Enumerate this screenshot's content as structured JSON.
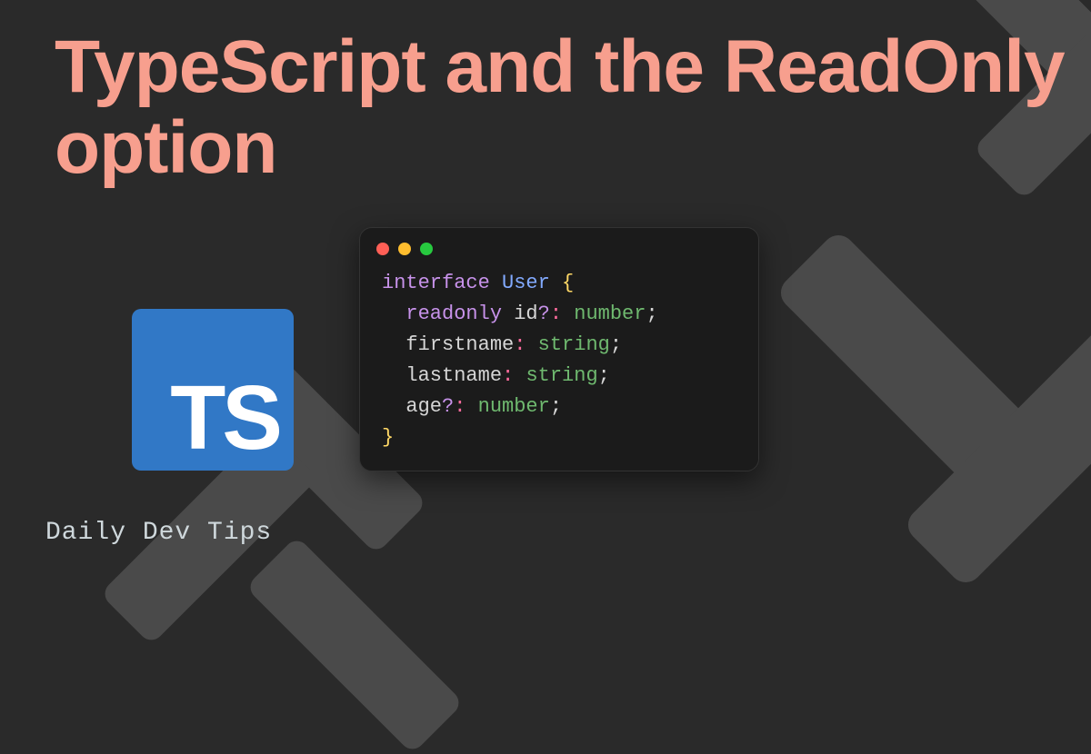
{
  "title": "TypeScript and the ReadOnly option",
  "logo": {
    "text": "TS"
  },
  "footer": "Daily Dev Tips",
  "code": {
    "keyword_interface": "interface",
    "type_name": "User",
    "brace_open": "{",
    "brace_close": "}",
    "lines": [
      {
        "readonly": "readonly",
        "prop": "id",
        "optional": "?",
        "colon": ":",
        "type": "number",
        "semi": ";"
      },
      {
        "readonly": "",
        "prop": "firstname",
        "optional": "",
        "colon": ":",
        "type": "string",
        "semi": ";"
      },
      {
        "readonly": "",
        "prop": "lastname",
        "optional": "",
        "colon": ":",
        "type": "string",
        "semi": ";"
      },
      {
        "readonly": "",
        "prop": "age",
        "optional": "?",
        "colon": ":",
        "type": "number",
        "semi": ";"
      }
    ]
  }
}
